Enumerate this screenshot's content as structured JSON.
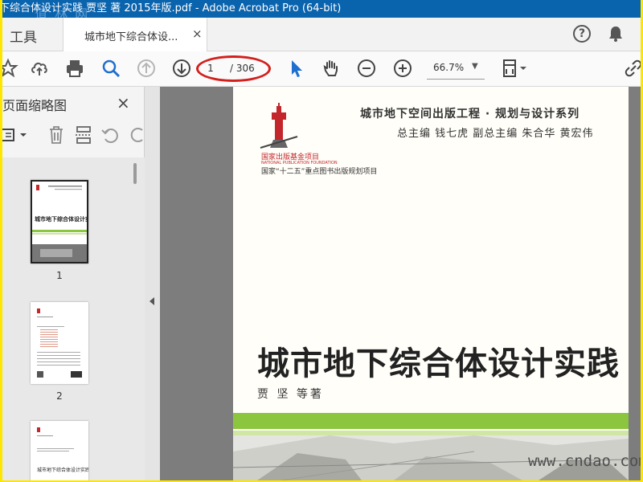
{
  "window": {
    "title": "下综合体设计实践 贾坚 著 2015年版.pdf - Adobe Acrobat Pro (64-bit)"
  },
  "tabs": {
    "tools_label": "工具",
    "document_label": "城市地下综合体设...",
    "close_glyph": "×"
  },
  "header": {
    "help_glyph": "?"
  },
  "toolbar": {
    "current_page": "1",
    "total_pages": "/ 306",
    "zoom": "66.7%",
    "icons": [
      "star-icon",
      "upload-icon",
      "print-icon",
      "zoom-search-icon",
      "previous-page-icon",
      "next-page-icon",
      "select-arrow-icon",
      "hand-icon",
      "zoom-out-icon",
      "zoom-in-icon",
      "fit-page-icon",
      "link-icon"
    ]
  },
  "thumbnails": {
    "pane_title": "页面缩略图",
    "close_glyph": "×",
    "pages": [
      {
        "number": "1",
        "mini_title": "城市地下综合体设计实践"
      },
      {
        "number": "2"
      },
      {
        "number": "",
        "mini_title": "城市地下综合体设计实践"
      }
    ]
  },
  "document": {
    "series_title": "城市地下空间出版工程 · 规划与设计系列",
    "editors": "总主编  钱七虎    副总主编 朱合华  黄宏伟",
    "fund_cn": "国家出版基金项目",
    "fund_en": "NATIONAL PUBLICATION FOUNDATION",
    "project": "国家“十二五”重点图书出版规划项目",
    "book_title": "城市地下综合体设计实践",
    "author": "贾 坚 等著"
  },
  "watermarks": {
    "top_left": "道 林 网",
    "bottom_right": "www.cndao.com"
  },
  "colors": {
    "titlebar": "#0a63ad",
    "highlight_ellipse": "#d2201d",
    "green_band": "#8cc63f",
    "select_arrow": "#1f6fd0",
    "outer_border": "#ffe600"
  }
}
